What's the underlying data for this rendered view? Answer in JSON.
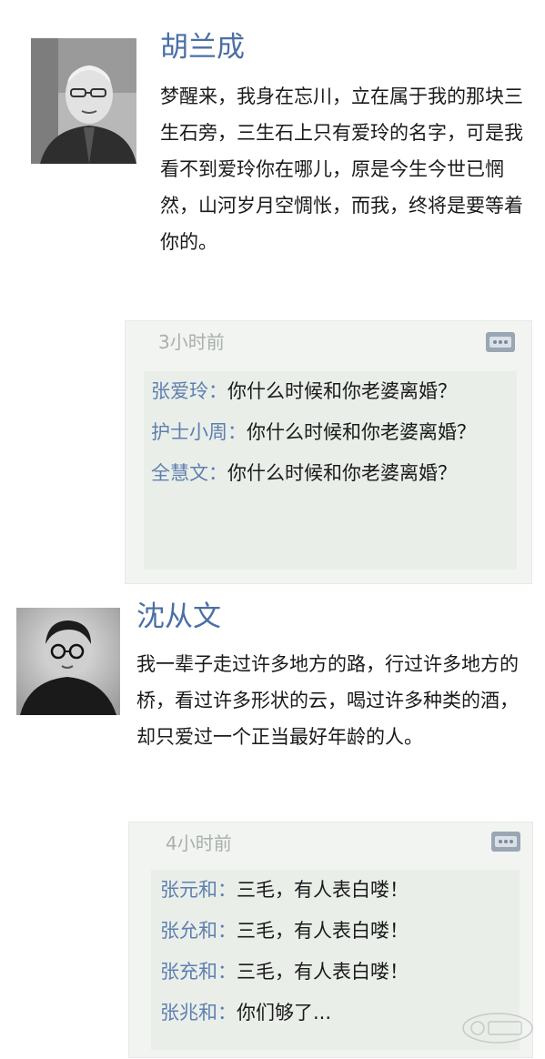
{
  "posts": [
    {
      "author": "胡兰成",
      "avatar_icon": "elderly-man-portrait",
      "text": "梦醒来，我身在忘川，立在属于我的那块三生石旁，三生石上只有爱玲的名字，可是我看不到爱玲你在哪儿，原是今生今世已惘然，山河岁月空惆怅，而我，终将是要等着你的。",
      "time": "3小时前",
      "replies": [
        {
          "name": "张爱玲",
          "sep": "：",
          "text": "你什么时候和你老婆离婚？"
        },
        {
          "name": "护士小周",
          "sep": "：",
          "text": "你什么时候和你老婆离婚？"
        },
        {
          "name": "全慧文",
          "sep": "：",
          "text": "你什么时候和你老婆离婚？"
        }
      ]
    },
    {
      "author": "沈从文",
      "avatar_icon": "man-with-glasses-portrait",
      "text": "我一辈子走过许多地方的路，行过许多地方的桥，看过许多形状的云，喝过许多种类的酒，却只爱过一个正当最好年龄的人。",
      "time": "4小时前",
      "replies": [
        {
          "name": "张元和",
          "sep": "：",
          "text": "三毛，有人表白喽！"
        },
        {
          "name": "张允和",
          "sep": "：",
          "text": "三毛，有人表白喽！"
        },
        {
          "name": "张充和",
          "sep": "：",
          "text": "三毛，有人表白喽！"
        },
        {
          "name": "张兆和",
          "sep": "：",
          "text": "你们够了..."
        }
      ]
    }
  ],
  "icons": {
    "comment": "comment-bubble-icon",
    "watermark": "site-watermark-logo"
  },
  "colors": {
    "author": "#4a6fa5",
    "reply_name": "#5e7fb0",
    "reply_bg": "#e9eee9",
    "time": "#a9b0a9"
  }
}
